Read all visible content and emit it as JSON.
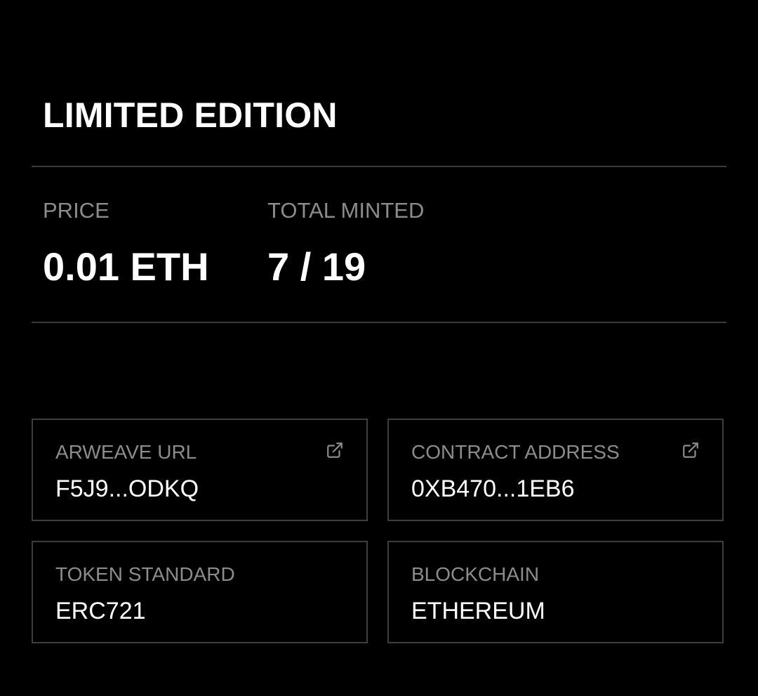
{
  "header": {
    "title": "LIMITED EDITION"
  },
  "stats": {
    "price_label": "PRICE",
    "price_value": "0.01 ETH",
    "minted_label": "TOTAL MINTED",
    "minted_value": "7 / 19"
  },
  "details": {
    "arweave": {
      "label": "ARWEAVE URL",
      "value": "F5J9...ODKQ",
      "icon": "external-link-icon"
    },
    "contract": {
      "label": "CONTRACT ADDRESS",
      "value": "0XB470...1EB6",
      "icon": "external-link-icon"
    },
    "token_standard": {
      "label": "TOKEN STANDARD",
      "value": "ERC721"
    },
    "blockchain": {
      "label": "BLOCKCHAIN",
      "value": "ETHEREUM"
    }
  },
  "colors": {
    "background": "#000000",
    "text_primary": "#ffffff",
    "text_muted": "#8c8c8c",
    "border": "#3e3e3e"
  }
}
